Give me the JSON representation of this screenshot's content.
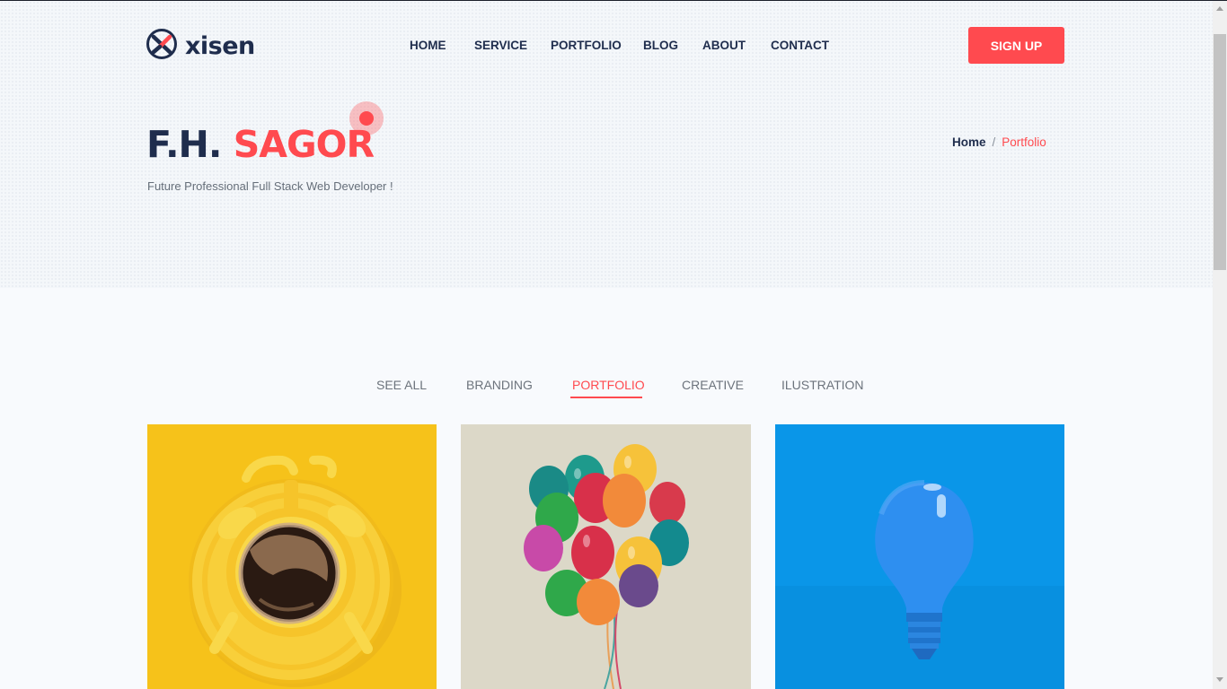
{
  "header": {
    "logo_text": "xisen",
    "nav": [
      "HOME",
      "SERVICE",
      "PORTFOLIO",
      "BLOG",
      "ABOUT",
      "CONTACT"
    ],
    "signup_label": "SIGN UP"
  },
  "hero": {
    "title_first": "F.H.",
    "title_last": "SAGOR",
    "subtitle": "Future Professional Full Stack Web Developer !",
    "breadcrumb": {
      "home": "Home",
      "separator": "/",
      "current": "Portfolio"
    }
  },
  "filters": {
    "items": [
      "SEE ALL",
      "BRANDING",
      "PORTFOLIO",
      "CREATIVE",
      "ILUSTRATION"
    ],
    "active": "PORTFOLIO"
  },
  "portfolio": {
    "items": [
      {
        "image": "coffee-alarm-clock-image"
      },
      {
        "image": "balloons-image"
      },
      {
        "image": "light-bulb-image"
      }
    ]
  },
  "colors": {
    "accent": "#ff4a4f",
    "navy": "#1f2d4d",
    "card_yellow": "#f6c21a",
    "card_beige": "#dcd8c8",
    "card_blue": "#0a96e8"
  }
}
